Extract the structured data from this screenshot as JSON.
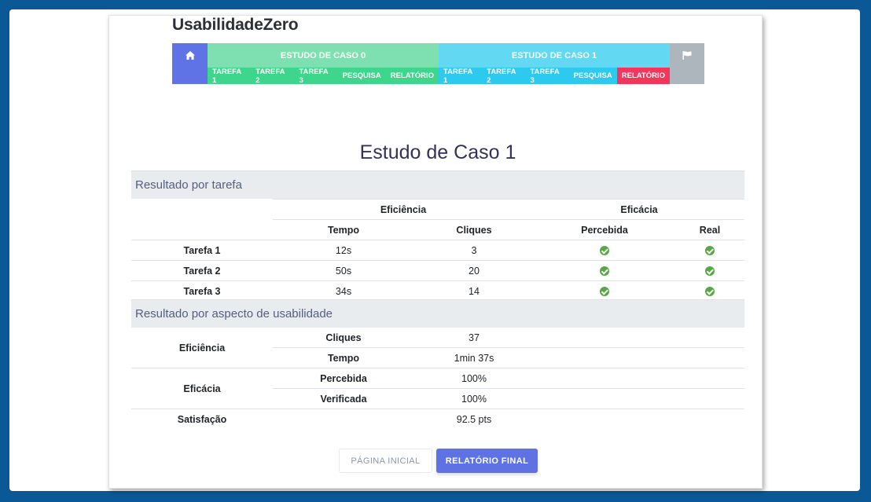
{
  "brand": "UsabilidadeZero",
  "nav": {
    "home_icon": "home-icon",
    "flag_icon": "flag-icon",
    "case0": {
      "title": "ESTUDO DE CASO 0",
      "tabs": [
        "TAREFA 1",
        "TAREFA 2",
        "TAREFA 3",
        "PESQUISA",
        "RELATÓRIO"
      ]
    },
    "case1": {
      "title": "ESTUDO DE CASO 1",
      "tabs": [
        "TAREFA 1",
        "TAREFA 2",
        "TAREFA 3",
        "PESQUISA",
        "RELATÓRIO"
      ],
      "active_tab": "RELATÓRIO"
    }
  },
  "page_title": "Estudo de Caso 1",
  "task_results": {
    "heading": "Resultado por tarefa",
    "group_headers": [
      "Eficiência",
      "Eficácia"
    ],
    "column_headers": [
      "Tempo",
      "Cliques",
      "Percebida",
      "Real"
    ],
    "rows": [
      {
        "task": "Tarefa 1",
        "time": "12s",
        "clicks": "3",
        "perceived": true,
        "real": true
      },
      {
        "task": "Tarefa 2",
        "time": "50s",
        "clicks": "20",
        "perceived": true,
        "real": true
      },
      {
        "task": "Tarefa 3",
        "time": "34s",
        "clicks": "14",
        "perceived": true,
        "real": true
      }
    ],
    "check_icon": "check-circle-icon",
    "check_color": "#55a845"
  },
  "aspect_results": {
    "heading": "Resultado por aspecto de usabilidade",
    "efficiency": {
      "label": "Eficiência",
      "clicks_label": "Cliques",
      "clicks": "37",
      "time_label": "Tempo",
      "time": "1min 37s"
    },
    "efficacy": {
      "label": "Eficácia",
      "perceived_label": "Percebida",
      "perceived": "100%",
      "verified_label": "Verificada",
      "verified": "100%"
    },
    "satisfaction": {
      "label": "Satisfação",
      "value": "92.5 pts"
    }
  },
  "buttons": {
    "home": "PÁGINA INICIAL",
    "final_report": "RELATÓRIO FINAL"
  },
  "colors": {
    "background": "#0a5996",
    "case0": "#3dd68c",
    "case1": "#2dc9ef",
    "active_tab": "#f5365c",
    "primary": "#5e72e4"
  }
}
